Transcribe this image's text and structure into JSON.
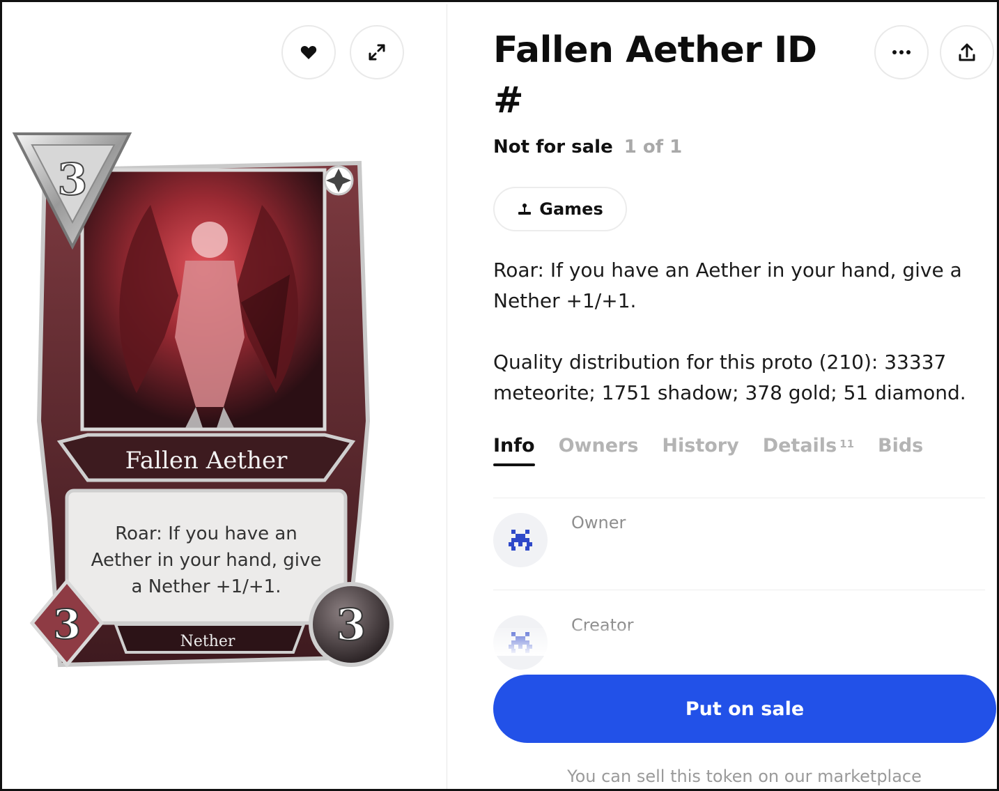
{
  "item": {
    "title": "Fallen Aether ID #",
    "sale_status": "Not for sale",
    "edition": "1 of 1",
    "category": "Games",
    "description_1": "Roar: If you have an Aether in your hand, give a Nether +1/+1.",
    "description_2": "Quality distribution for this proto (210): 33337 meteorite; 1751 shadow; 378 gold; 51 diamond."
  },
  "card": {
    "name": "Fallen Aether",
    "effect_lines": [
      "Roar: If you have an",
      "Aether in your hand, give",
      "a Nether +1/+1."
    ],
    "tribe": "Nether",
    "mana": "3",
    "attack": "3",
    "health": "3"
  },
  "tabs": [
    {
      "label": "Info",
      "active": true
    },
    {
      "label": "Owners",
      "active": false
    },
    {
      "label": "History",
      "active": false
    },
    {
      "label": "Details",
      "count": "11",
      "active": false
    },
    {
      "label": "Bids",
      "active": false
    }
  ],
  "people": {
    "owner_label": "Owner",
    "creator_label": "Creator"
  },
  "actions": {
    "put_on_sale": "Put on sale",
    "sell_note": "You can sell this token on our marketplace"
  },
  "icons": {
    "like": "heart-icon",
    "expand": "expand-icon",
    "more": "more-icon",
    "share": "share-icon",
    "games": "joystick-icon"
  },
  "colors": {
    "accent": "#2251e8",
    "card_frame": "#6b2f35",
    "card_art": "#b8323a"
  }
}
